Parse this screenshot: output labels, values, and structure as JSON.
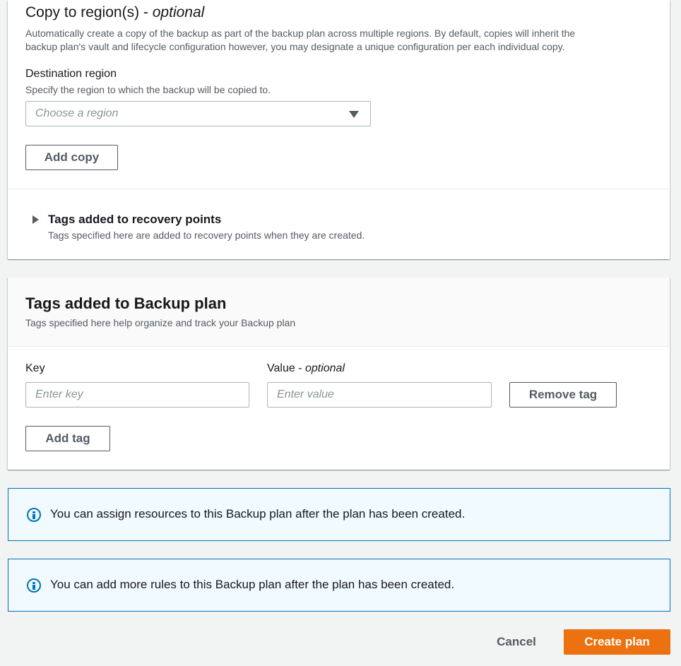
{
  "copy_section": {
    "title": "Copy to region(s)",
    "title_suffix": "optional",
    "description_line1": "Automatically create a copy of the backup as part of the backup plan across multiple regions. By default, copies will inherit the",
    "description_line2": "backup plan's vault and lifecycle configuration however, you may designate a unique configuration per each individual copy.",
    "destination_label": "Destination region",
    "destination_hint": "Specify the region to which the backup will be copied to.",
    "region_placeholder": "Choose a region",
    "add_copy_label": "Add copy",
    "recovery_tags_title": "Tags added to recovery points",
    "recovery_tags_desc": "Tags specified here are added to recovery points when they are created."
  },
  "tags_section": {
    "title": "Tags added to Backup plan",
    "description": "Tags specified here help organize and track your Backup plan",
    "key_label": "Key",
    "value_label": "Value",
    "value_suffix": "optional",
    "key_placeholder": "Enter key",
    "value_placeholder": "Enter value",
    "remove_tag_label": "Remove tag",
    "add_tag_label": "Add tag"
  },
  "info_alerts": [
    {
      "message": "You can assign resources to this Backup plan after the plan has been created."
    },
    {
      "message": "You can add more rules to this Backup plan after the plan has been created."
    }
  ],
  "footer": {
    "cancel_label": "Cancel",
    "create_label": "Create plan"
  },
  "colors": {
    "accent": "#ec7211",
    "info_border": "#0073bb",
    "info_bg": "#f1faff"
  },
  "icons": {
    "dropdown": "caret-down-icon",
    "expand": "caret-right-icon",
    "info": "info-circle-icon"
  }
}
